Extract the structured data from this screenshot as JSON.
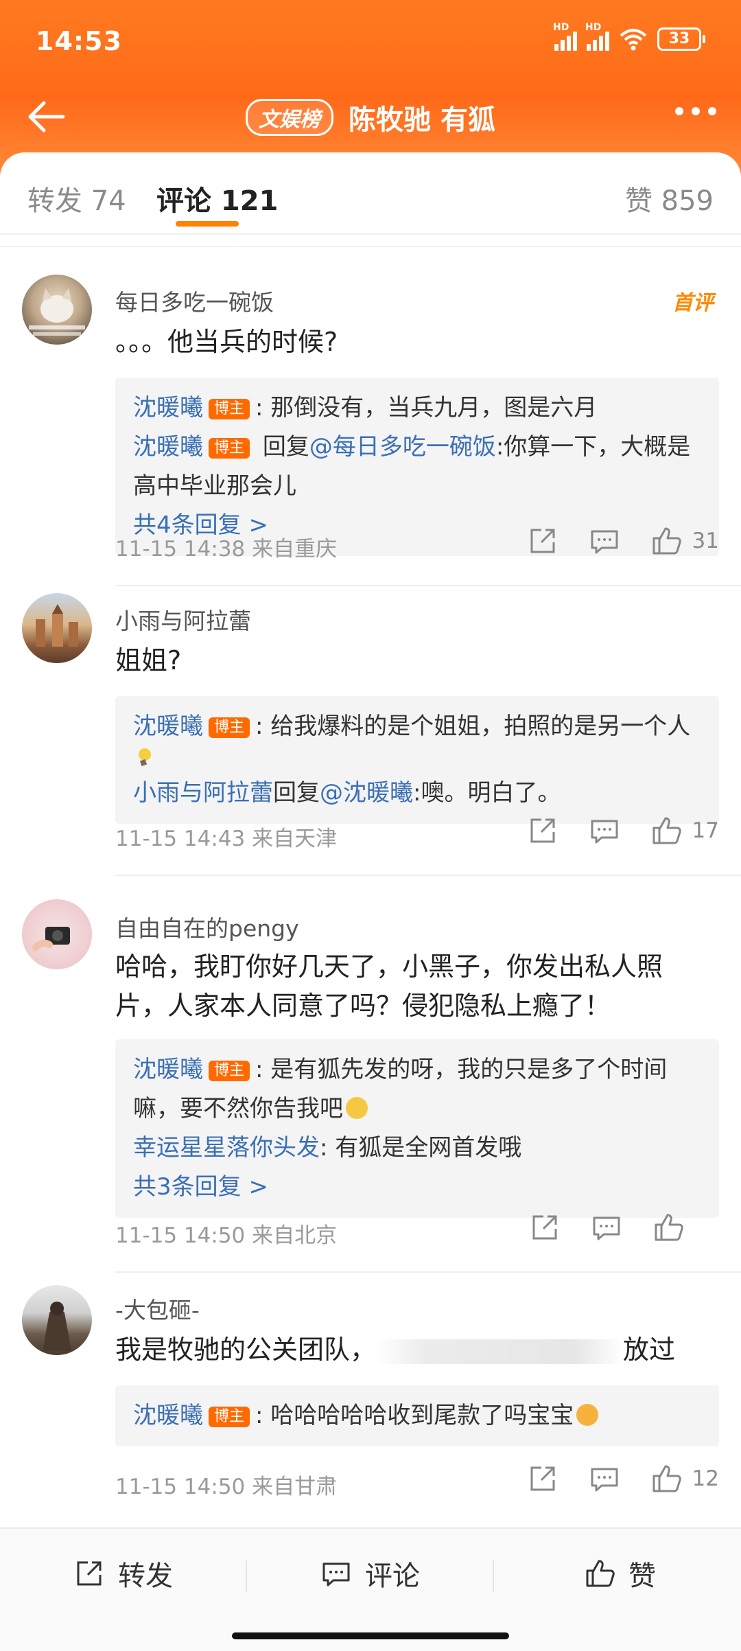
{
  "status": {
    "time": "14:53",
    "battery": "33",
    "hd1": "HD",
    "hd2": "HD"
  },
  "nav": {
    "badge": "文娱榜",
    "title": "陈牧驰 有狐"
  },
  "tabs": {
    "repost": "转发 74",
    "comment": "评论 121",
    "like": "赞 859"
  },
  "comments": [
    {
      "username": "每日多吃一碗饭",
      "text": "。。。他当兵的时候?",
      "hot_badge": "首评",
      "replies": [
        {
          "name": "沈暖曦",
          "bozhu": "博主",
          "text": ": 那倒没有，当兵九月，图是六月"
        },
        {
          "name": "沈暖曦",
          "bozhu": "博主",
          "mid": " 回复",
          "at": "@每日多吃一碗饭",
          "text": ":你算一下，大概是高中毕业那会儿"
        }
      ],
      "more_replies": "共4条回复 >",
      "meta": "11-15 14:38  来自重庆",
      "likes": "31"
    },
    {
      "username": "小雨与阿拉蕾",
      "text": "姐姐?",
      "replies": [
        {
          "name": "沈暖曦",
          "bozhu": "博主",
          "text": ": 给我爆料的是个姐姐，拍照的是另一个人"
        },
        {
          "name": "小雨与阿拉蕾",
          "mid": "回复",
          "at": "@沈暖曦",
          "text": ":噢。明白了。"
        }
      ],
      "meta": "11-15 14:43  来自天津",
      "likes": "17"
    },
    {
      "username": "自由自在的pengy",
      "text": "哈哈，我盯你好几天了，小黑子，你发出私人照片，人家本人同意了吗？侵犯隐私上瘾了！",
      "replies": [
        {
          "name": "沈暖曦",
          "bozhu": "博主",
          "text": ": 是有狐先发的呀，我的只是多了个时间嘛，要不然你告我吧"
        },
        {
          "name": "幸运星星落你头发",
          "text": ": 有狐是全网首发哦"
        }
      ],
      "more_replies": "共3条回复 >",
      "meta": "11-15 14:50  来自北京",
      "likes": ""
    },
    {
      "username": "-大包砸-",
      "text_before": "我是牧驰的公关团队，",
      "text_after": "放过",
      "replies": [
        {
          "name": "沈暖曦",
          "bozhu": "博主",
          "text": ": 哈哈哈哈哈收到尾款了吗宝宝"
        }
      ],
      "meta": "11-15 14:50  来自甘肃",
      "likes": "12"
    }
  ],
  "bottom": {
    "repost": "转发",
    "comment": "评论",
    "like": "赞"
  },
  "colors": {
    "accent": "#ff8200",
    "link": "#3a6fb5",
    "bozhu_badge": "#ff6a00"
  }
}
